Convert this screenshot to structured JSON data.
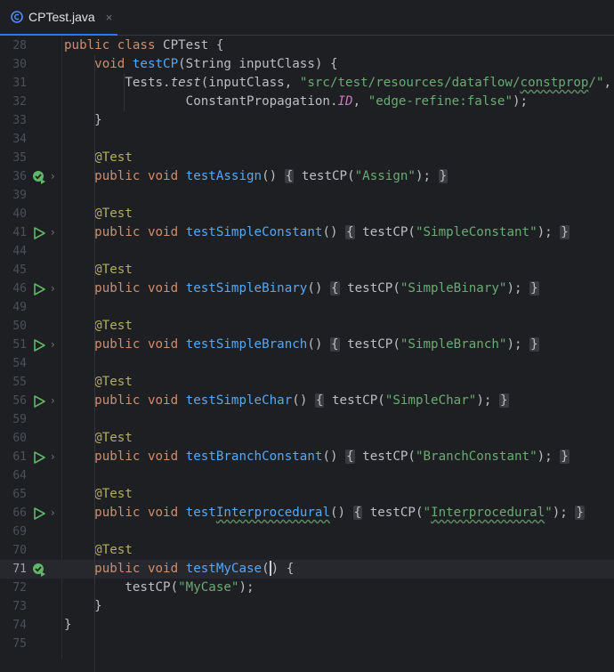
{
  "tab": {
    "filename": "CPTest.java",
    "close": "×",
    "icon": "java-class-icon"
  },
  "colors": {
    "keyword": "#cf8e6d",
    "function": "#56a8f5",
    "string": "#6aab73",
    "annotation": "#b3ae60",
    "constant": "#c77dbb",
    "background": "#1e1f22"
  },
  "lines": {
    "l28": {
      "n": "28",
      "kw1": "public",
      "kw2": "class",
      "rest": " CPTest {"
    },
    "l30": {
      "n": "30",
      "kw": "void",
      "fn": "testCP",
      "rest": "(String inputClass) {"
    },
    "l31": {
      "n": "31",
      "a": "Tests.",
      "b": "test",
      "c": "(inputClass, ",
      "s1": "\"src/test/resources/dataflow/",
      "s2": "constprop",
      "s3": "/\"",
      "d": ","
    },
    "l32": {
      "n": "32",
      "a": "ConstantPropagation.",
      "b": "ID",
      "c": ", ",
      "s": "\"edge-refine:false\"",
      "d": ");"
    },
    "l33": {
      "n": "33",
      "t": "}"
    },
    "l34": {
      "n": "34"
    },
    "tests": [
      {
        "a_n": "35",
        "annotation": "@Test",
        "n": "36",
        "name": "testAssign",
        "arg": "\"Assign\"",
        "status": "passed"
      },
      {
        "a_n": "40",
        "annotation": "@Test",
        "n": "41",
        "name": "testSimpleConstant",
        "arg": "\"SimpleConstant\"",
        "status": "run"
      },
      {
        "a_n": "45",
        "annotation": "@Test",
        "n": "46",
        "name": "testSimpleBinary",
        "arg": "\"SimpleBinary\"",
        "status": "run"
      },
      {
        "a_n": "50",
        "annotation": "@Test",
        "n": "51",
        "name": "testSimpleBranch",
        "arg": "\"SimpleBranch\"",
        "status": "run"
      },
      {
        "a_n": "55",
        "annotation": "@Test",
        "n": "56",
        "name": "testSimpleChar",
        "arg": "\"SimpleChar\"",
        "status": "run"
      },
      {
        "a_n": "60",
        "annotation": "@Test",
        "n": "61",
        "name": "testBranchConstant",
        "arg": "\"BranchConstant\"",
        "status": "run"
      },
      {
        "a_n": "65",
        "annotation": "@Test",
        "n": "66",
        "name_a": "test",
        "name_b": "Interprocedural",
        "arg_q1": "\"",
        "arg": "Interprocedural",
        "arg_q2": "\"",
        "status": "run"
      }
    ],
    "blank_after": [
      "39",
      "44",
      "49",
      "54",
      "59",
      "64",
      "69"
    ],
    "l70": {
      "n": "70",
      "annotation": "@Test"
    },
    "l71": {
      "n": "71",
      "kw1": "public",
      "kw2": "void",
      "fn": "testMyCase",
      "rest": " {"
    },
    "l72": {
      "n": "72",
      "a": "testCP(",
      "s": "\"MyCase\"",
      "b": ");"
    },
    "l73": {
      "n": "73",
      "t": "}"
    },
    "l74": {
      "n": "74",
      "t": "}"
    },
    "l75": {
      "n": "75"
    }
  },
  "common": {
    "public": "public",
    "void": "void",
    "call": "testCP(",
    "close": ");",
    "lbrace": "{",
    "rbrace": "}",
    "parens": "()"
  }
}
